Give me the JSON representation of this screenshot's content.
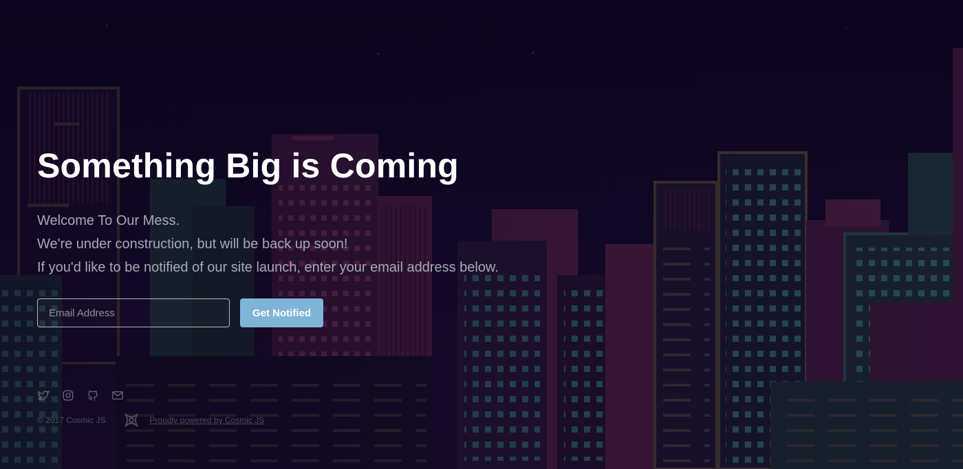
{
  "hero": {
    "headline": "Something Big is Coming",
    "lines": [
      "Welcome To Our Mess.",
      "We're under construction, but will be back up soon!",
      "If you'd like to be notified of our site launch, enter your email address below."
    ]
  },
  "form": {
    "email_placeholder": "Email Address",
    "email_value": "",
    "button_label": "Get Notified"
  },
  "social": [
    "twitter-icon",
    "instagram-icon",
    "github-icon",
    "mail-icon"
  ],
  "footer": {
    "copyright": "© 2017 Cosmic JS",
    "powered_by": "Proudly powered by Cosmic JS",
    "logo_icon": "cosmic-logo-icon"
  },
  "colors": {
    "background": "#0d0620",
    "button": "#7fb4d6",
    "text_primary": "#ffffff",
    "text_secondary": "#a7a9b6"
  }
}
